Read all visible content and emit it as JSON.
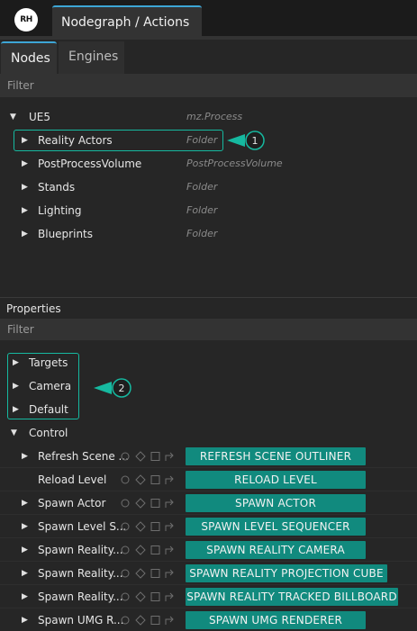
{
  "titlebar": {
    "logo_text": "RH",
    "doc_tab": "Nodegraph / Actions"
  },
  "tabs": [
    {
      "label": "Nodes"
    },
    {
      "label": "Engines"
    }
  ],
  "nodes_filter": {
    "placeholder": "Filter"
  },
  "tree": {
    "root": {
      "label": "UE5",
      "type": "mz.Process"
    },
    "children": [
      {
        "label": "Reality Actors",
        "type": "Folder"
      },
      {
        "label": "PostProcessVolume",
        "type": "PostProcessVolume"
      },
      {
        "label": "Stands",
        "type": "Folder"
      },
      {
        "label": "Lighting",
        "type": "Folder"
      },
      {
        "label": "Blueprints",
        "type": "Folder"
      }
    ]
  },
  "callouts": {
    "one": "1",
    "two": "2"
  },
  "properties": {
    "title": "Properties",
    "filter_placeholder": "Filter",
    "groups": [
      {
        "label": "Targets"
      },
      {
        "label": "Camera"
      },
      {
        "label": "Default"
      }
    ],
    "control": {
      "label": "Control",
      "rows": [
        {
          "label": "Refresh Scene ...",
          "button": "REFRESH SCENE OUTLINER"
        },
        {
          "label": "Reload Level",
          "button": "RELOAD LEVEL"
        },
        {
          "label": "Spawn Actor",
          "button": "SPAWN ACTOR"
        },
        {
          "label": "Spawn Level S...",
          "button": "SPAWN LEVEL SEQUENCER"
        },
        {
          "label": "Spawn Reality...",
          "button": "SPAWN REALITY CAMERA"
        },
        {
          "label": "Spawn Reality...",
          "button": "SPAWN REALITY PROJECTION CUBE"
        },
        {
          "label": "Spawn Reality...",
          "button": "SPAWN REALITY TRACKED BILLBOARD"
        },
        {
          "label": "Spawn UMG R...",
          "button": "SPAWN UMG RENDERER"
        }
      ]
    }
  },
  "colors": {
    "accent_tab": "#3da6d6",
    "teal_button": "#118a7e",
    "highlight": "#16b9a0"
  }
}
